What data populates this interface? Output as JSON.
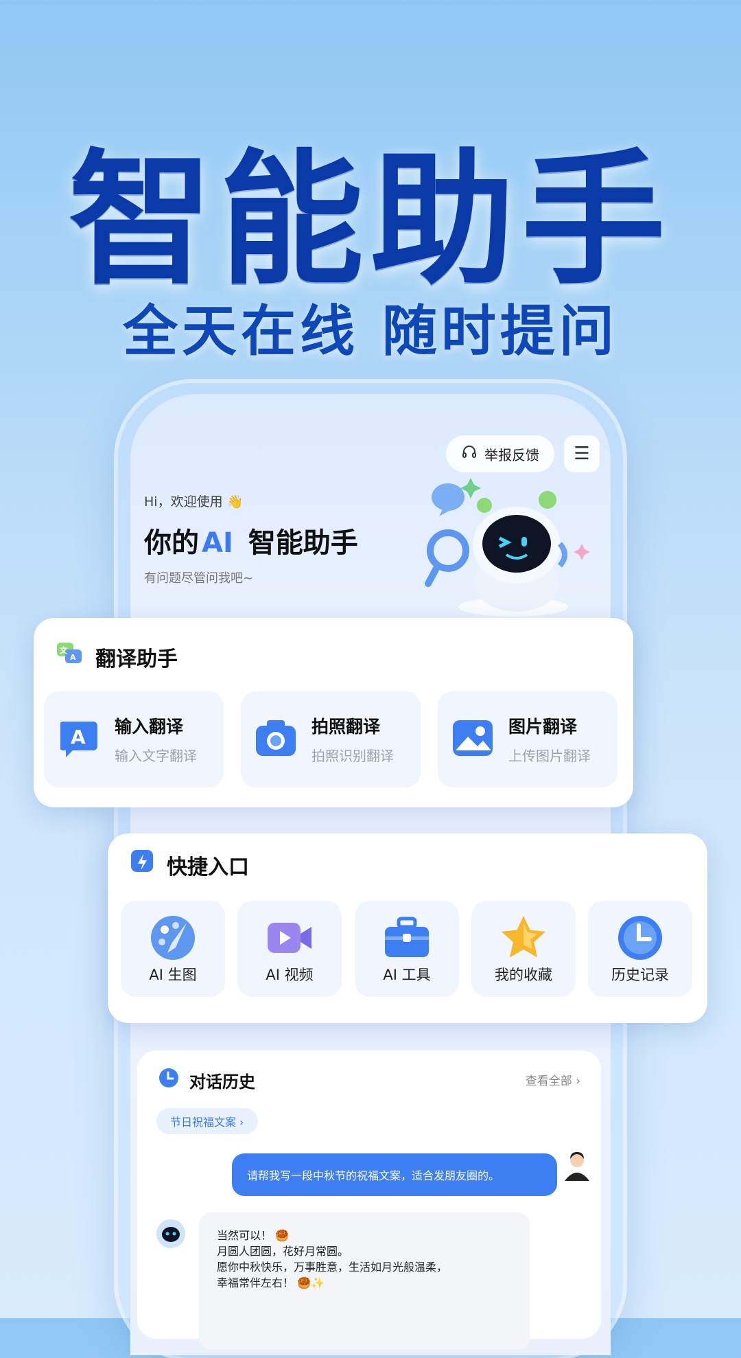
{
  "hero": {
    "title": "智能助手",
    "subtitle": "全天在线 随时提问"
  },
  "app": {
    "report_label": "举报反馈",
    "menu_icon": "hamburger-icon",
    "greeting": "Hi，欢迎使用 👋",
    "headline_prefix": "你的",
    "headline_ai": "AI",
    "headline_suffix": "智能助手",
    "tagline": "有问题尽管问我吧~"
  },
  "translate": {
    "title": "翻译助手",
    "items": [
      {
        "title": "输入翻译",
        "sub": "输入文字翻译",
        "icon": "letter-a-icon"
      },
      {
        "title": "拍照翻译",
        "sub": "拍照识别翻译",
        "icon": "camera-icon"
      },
      {
        "title": "图片翻译",
        "sub": "上传图片翻译",
        "icon": "image-icon"
      }
    ]
  },
  "quick": {
    "title": "快捷入口",
    "items": [
      {
        "label": "AI 生图",
        "icon": "palette-icon"
      },
      {
        "label": "AI 视频",
        "icon": "video-icon"
      },
      {
        "label": "AI 工具",
        "icon": "toolbox-icon"
      },
      {
        "label": "我的收藏",
        "icon": "star-icon"
      },
      {
        "label": "历史记录",
        "icon": "clock-icon"
      }
    ]
  },
  "history": {
    "title": "对话历史",
    "view_all": "查看全部 ›",
    "tag": "节日祝福文案 ›",
    "user_message": "请帮我写一段中秋节的祝福文案，适合发朋友圈的。",
    "bot_lines": [
      "当然可以！ 🥮",
      "月圆人团圆，花好月常圆。",
      "愿你中秋快乐，万事胜意，生活如月光般温柔，",
      "幸福常伴左右！ 🥮✨"
    ]
  },
  "colors": {
    "title_blue": "#0a3aa8",
    "accent_blue": "#3d7ef3",
    "card_bg": "#ffffff",
    "tile_bg": "#f1f6fe"
  }
}
